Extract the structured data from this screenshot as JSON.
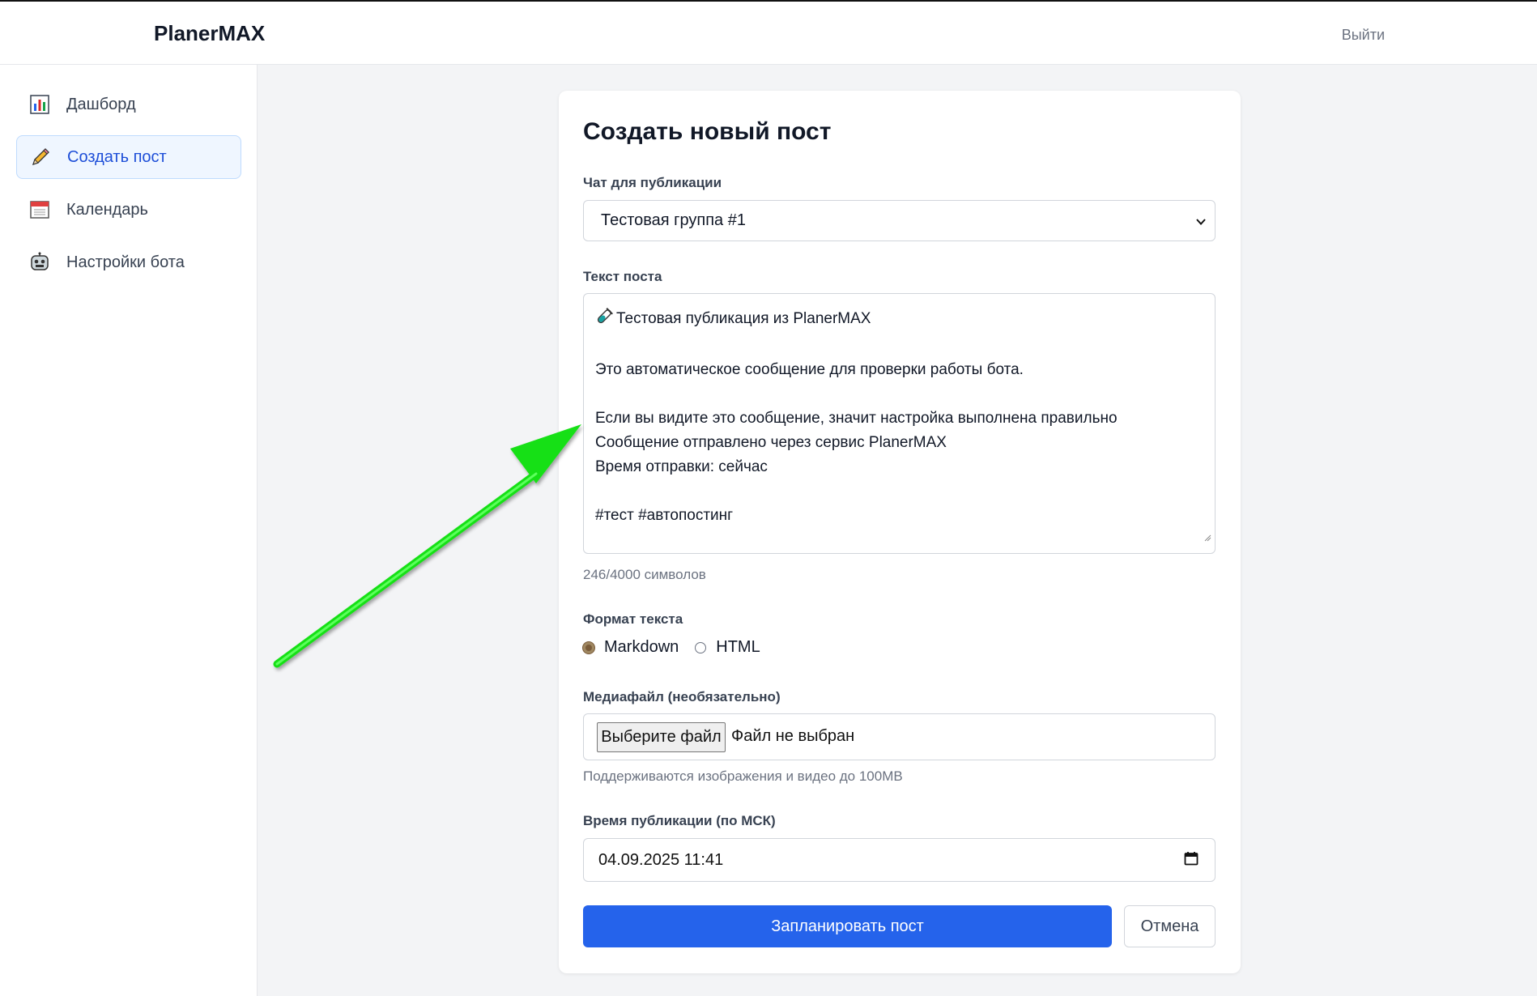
{
  "header": {
    "brand": "PlanerMAX",
    "logout": "Выйти"
  },
  "sidebar": {
    "items": [
      {
        "label": "Дашборд",
        "icon": "bar-chart-icon",
        "active": false
      },
      {
        "label": "Создать пост",
        "icon": "pencil-icon",
        "active": true
      },
      {
        "label": "Календарь",
        "icon": "calendar-icon",
        "active": false
      },
      {
        "label": "Настройки бота",
        "icon": "robot-icon",
        "active": false
      }
    ]
  },
  "form": {
    "title": "Создать новый пост",
    "chat_label": "Чат для публикации",
    "chat_value": "Тестовая группа #1",
    "text_label": "Текст поста",
    "text_value": "Тестовая публикация из PlanerMAX\n\nЭто автоматическое сообщение для проверки работы бота.\n\nЕсли вы видите это сообщение, значит настройка выполнена правильно\nСообщение отправлено через сервис PlanerMAX\nВремя отправки: сейчас\n\n#тест #автопостинг",
    "char_count": "246/4000 символов",
    "format_label": "Формат текста",
    "format_options": [
      "Markdown",
      "HTML"
    ],
    "format_selected": "Markdown",
    "media_label": "Медиафайл (необязательно)",
    "file_button": "Выберите файл",
    "file_status": "Файл не выбран",
    "media_hint": "Поддерживаются изображения и видео до 100MB",
    "time_label": "Время публикации (по МСК)",
    "time_value": "04.09.2025 11:41",
    "submit": "Запланировать пост",
    "cancel": "Отмена"
  },
  "colors": {
    "primary": "#2563eb",
    "active_nav_bg": "#eff6ff",
    "active_nav_text": "#1d4ed8",
    "annotation_arrow": "#22ff22"
  }
}
